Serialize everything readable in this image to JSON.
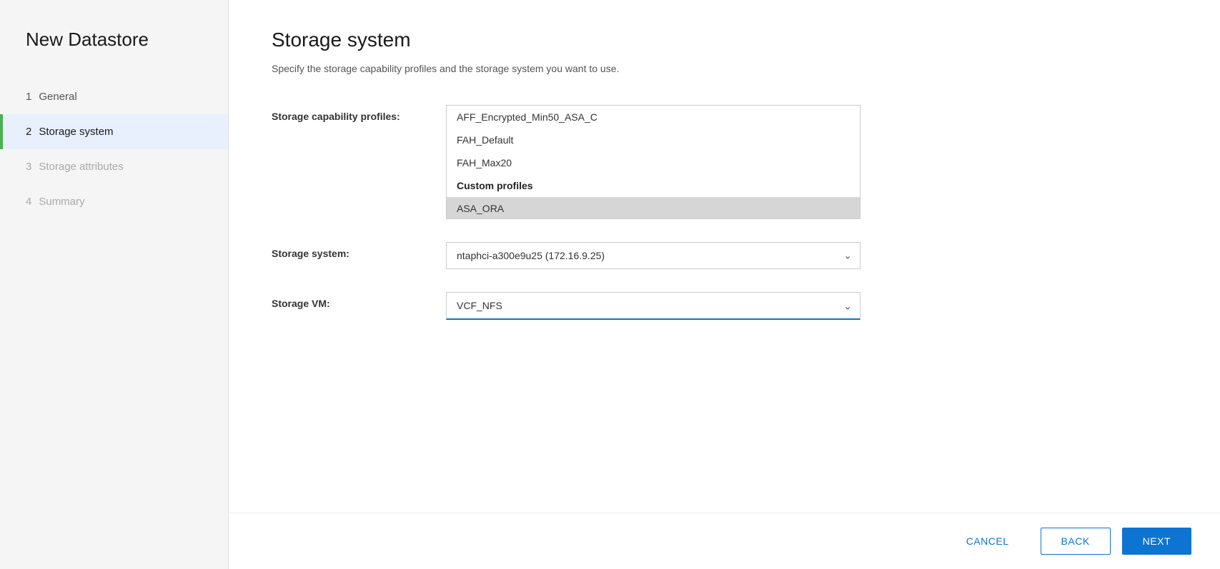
{
  "sidebar": {
    "title": "New Datastore",
    "steps": [
      {
        "id": "general",
        "number": "1",
        "label": "General",
        "state": "completed"
      },
      {
        "id": "storage-system",
        "number": "2",
        "label": "Storage system",
        "state": "active"
      },
      {
        "id": "storage-attributes",
        "number": "3",
        "label": "Storage attributes",
        "state": "inactive"
      },
      {
        "id": "summary",
        "number": "4",
        "label": "Summary",
        "state": "inactive"
      }
    ]
  },
  "main": {
    "title": "Storage system",
    "description": "Specify the storage capability profiles and the storage system you want to use.",
    "form": {
      "capability_profiles_label": "Storage capability profiles:",
      "storage_system_label": "Storage system:",
      "storage_vm_label": "Storage VM:",
      "listbox_items": [
        {
          "id": "aff-encrypted",
          "label": "AFF_Encrypted_Min50_ASA_C",
          "type": "item"
        },
        {
          "id": "fah-default",
          "label": "FAH_Default",
          "type": "item"
        },
        {
          "id": "fah-max20",
          "label": "FAH_Max20",
          "type": "item"
        },
        {
          "id": "custom-profiles",
          "label": "Custom profiles",
          "type": "category"
        },
        {
          "id": "asa-ora",
          "label": "ASA_ORA",
          "type": "item",
          "selected": true
        }
      ],
      "storage_system_value": "ntaphci-a300e9u25 (172.16.9.25)",
      "storage_vm_value": "VCF_NFS",
      "storage_system_options": [
        "ntaphci-a300e9u25 (172.16.9.25)"
      ],
      "storage_vm_options": [
        "VCF_NFS"
      ]
    },
    "actions": {
      "cancel_label": "CANCEL",
      "back_label": "BACK",
      "next_label": "NEXT"
    }
  },
  "icons": {
    "chevron_down": "&#8964;"
  }
}
